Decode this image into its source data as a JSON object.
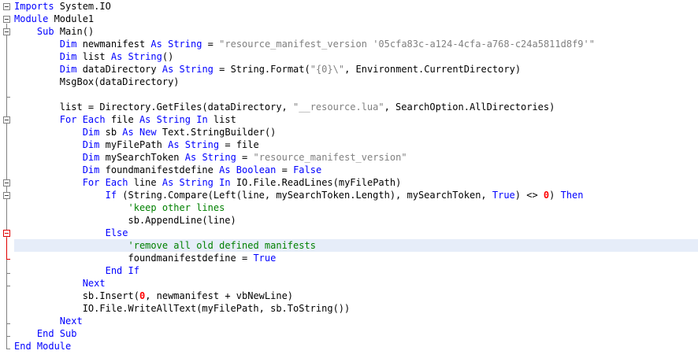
{
  "colors": {
    "keyword": "#0000ff",
    "string": "#808080",
    "comment": "#008000",
    "number": "#ff0000",
    "highlight": "#e6edf9",
    "fold_marker": "#808080",
    "fold_marker_error": "#e00000"
  },
  "code_lines": [
    [
      {
        "t": "Imports",
        "c": "kw"
      },
      {
        "t": " System.IO"
      }
    ],
    [
      {
        "t": "Module",
        "c": "kw"
      },
      {
        "t": " Module1"
      }
    ],
    [
      {
        "t": "    "
      },
      {
        "t": "Sub",
        "c": "kw"
      },
      {
        "t": " Main()"
      }
    ],
    [
      {
        "t": "        "
      },
      {
        "t": "Dim",
        "c": "kw"
      },
      {
        "t": " newmanifest "
      },
      {
        "t": "As",
        "c": "kw"
      },
      {
        "t": " "
      },
      {
        "t": "String",
        "c": "kw"
      },
      {
        "t": " = "
      },
      {
        "t": "\"resource_manifest_version '05cfa83c-a124-4cfa-a768-c24a5811d8f9'\"",
        "c": "str"
      }
    ],
    [
      {
        "t": "        "
      },
      {
        "t": "Dim",
        "c": "kw"
      },
      {
        "t": " list "
      },
      {
        "t": "As",
        "c": "kw"
      },
      {
        "t": " "
      },
      {
        "t": "String",
        "c": "kw"
      },
      {
        "t": "()"
      }
    ],
    [
      {
        "t": "        "
      },
      {
        "t": "Dim",
        "c": "kw"
      },
      {
        "t": " dataDirectory "
      },
      {
        "t": "As",
        "c": "kw"
      },
      {
        "t": " "
      },
      {
        "t": "String",
        "c": "kw"
      },
      {
        "t": " = String.Format("
      },
      {
        "t": "\"{0}\\\"",
        "c": "str"
      },
      {
        "t": ", Environment.CurrentDirectory)"
      }
    ],
    [
      {
        "t": "        MsgBox(dataDirectory)"
      }
    ],
    [
      {
        "t": ""
      }
    ],
    [
      {
        "t": "        list = Directory.GetFiles(dataDirectory, "
      },
      {
        "t": "\"__resource.lua\"",
        "c": "str"
      },
      {
        "t": ", SearchOption.AllDirectories)"
      }
    ],
    [
      {
        "t": "        "
      },
      {
        "t": "For Each",
        "c": "kw"
      },
      {
        "t": " file "
      },
      {
        "t": "As",
        "c": "kw"
      },
      {
        "t": " "
      },
      {
        "t": "String",
        "c": "kw"
      },
      {
        "t": " "
      },
      {
        "t": "In",
        "c": "kw"
      },
      {
        "t": " list"
      }
    ],
    [
      {
        "t": "            "
      },
      {
        "t": "Dim",
        "c": "kw"
      },
      {
        "t": " sb "
      },
      {
        "t": "As",
        "c": "kw"
      },
      {
        "t": " "
      },
      {
        "t": "New",
        "c": "kw"
      },
      {
        "t": " Text.StringBuilder()"
      }
    ],
    [
      {
        "t": "            "
      },
      {
        "t": "Dim",
        "c": "kw"
      },
      {
        "t": " myFilePath "
      },
      {
        "t": "As",
        "c": "kw"
      },
      {
        "t": " "
      },
      {
        "t": "String",
        "c": "kw"
      },
      {
        "t": " = file"
      }
    ],
    [
      {
        "t": "            "
      },
      {
        "t": "Dim",
        "c": "kw"
      },
      {
        "t": " mySearchToken "
      },
      {
        "t": "As",
        "c": "kw"
      },
      {
        "t": " "
      },
      {
        "t": "String",
        "c": "kw"
      },
      {
        "t": " = "
      },
      {
        "t": "\"resource_manifest_version\"",
        "c": "str"
      }
    ],
    [
      {
        "t": "            "
      },
      {
        "t": "Dim",
        "c": "kw"
      },
      {
        "t": " foundmanifestdefine "
      },
      {
        "t": "As",
        "c": "kw"
      },
      {
        "t": " "
      },
      {
        "t": "Boolean",
        "c": "kw"
      },
      {
        "t": " = "
      },
      {
        "t": "False",
        "c": "kw"
      }
    ],
    [
      {
        "t": "            "
      },
      {
        "t": "For Each",
        "c": "kw"
      },
      {
        "t": " line "
      },
      {
        "t": "As",
        "c": "kw"
      },
      {
        "t": " "
      },
      {
        "t": "String",
        "c": "kw"
      },
      {
        "t": " "
      },
      {
        "t": "In",
        "c": "kw"
      },
      {
        "t": " IO.File.ReadLines(myFilePath)"
      }
    ],
    [
      {
        "t": "                "
      },
      {
        "t": "If",
        "c": "kw"
      },
      {
        "t": " (String.Compare(Left(line, mySearchToken.Length), mySearchToken, "
      },
      {
        "t": "True",
        "c": "kw"
      },
      {
        "t": ") <> "
      },
      {
        "t": "0",
        "c": "num"
      },
      {
        "t": ") "
      },
      {
        "t": "Then",
        "c": "kw"
      }
    ],
    [
      {
        "t": "                    "
      },
      {
        "t": "'keep other lines",
        "c": "cmt"
      }
    ],
    [
      {
        "t": "                    sb.AppendLine(line)"
      }
    ],
    [
      {
        "t": "                "
      },
      {
        "t": "Else",
        "c": "kw"
      }
    ],
    [
      {
        "t": "                    "
      },
      {
        "t": "'remove all old defined manifests",
        "c": "cmt"
      }
    ],
    [
      {
        "t": "                    foundmanifestdefine = "
      },
      {
        "t": "True",
        "c": "kw"
      }
    ],
    [
      {
        "t": "                "
      },
      {
        "t": "End If",
        "c": "kw"
      }
    ],
    [
      {
        "t": "            "
      },
      {
        "t": "Next",
        "c": "kw"
      }
    ],
    [
      {
        "t": "            sb.Insert("
      },
      {
        "t": "0",
        "c": "num"
      },
      {
        "t": ", newmanifest + vbNewLine)"
      }
    ],
    [
      {
        "t": "            IO.File.WriteAllText(myFilePath, sb.ToString())"
      }
    ],
    [
      {
        "t": "        "
      },
      {
        "t": "Next",
        "c": "kw"
      }
    ],
    [
      {
        "t": "    "
      },
      {
        "t": "End Sub",
        "c": "kw"
      }
    ],
    [
      {
        "t": "End Module",
        "c": "kw"
      }
    ]
  ],
  "highlighted_line_number": 20,
  "fold_markers": [
    {
      "line": 1,
      "error": false
    },
    {
      "line": 2,
      "error": false
    },
    {
      "line": 3,
      "error": false
    },
    {
      "line": 10,
      "error": false
    },
    {
      "line": 15,
      "error": false
    },
    {
      "line": 16,
      "error": false
    },
    {
      "line": 19,
      "error": true
    }
  ]
}
